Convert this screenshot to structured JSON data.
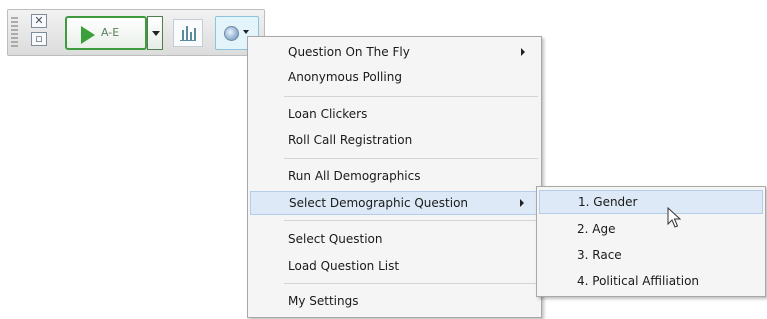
{
  "toolbar": {
    "play_label": "A-E",
    "icons": {
      "close": "close-icon",
      "small": "small-window-icon",
      "play": "play-icon",
      "chart": "bar-chart-icon",
      "globe": "globe-icon"
    }
  },
  "menu": {
    "items": [
      {
        "label": "Question On The Fly",
        "has_submenu": true
      },
      {
        "label": "Anonymous Polling"
      },
      {
        "label": "Loan Clickers"
      },
      {
        "label": "Roll Call Registration"
      },
      {
        "label": "Run All Demographics"
      },
      {
        "label": "Select Demographic Question",
        "has_submenu": true,
        "highlighted": true
      },
      {
        "label": "Select Question"
      },
      {
        "label": "Load Question List"
      },
      {
        "label": "My Settings"
      }
    ]
  },
  "submenu": {
    "items": [
      {
        "label": "1. Gender",
        "highlighted": true
      },
      {
        "label": "2. Age"
      },
      {
        "label": "3. Race"
      },
      {
        "label": "4. Political Affiliation"
      }
    ]
  },
  "colors": {
    "accent_green": "#3aa13a",
    "highlight": "#dde9f6",
    "menu_bg": "#f5f5f5"
  }
}
